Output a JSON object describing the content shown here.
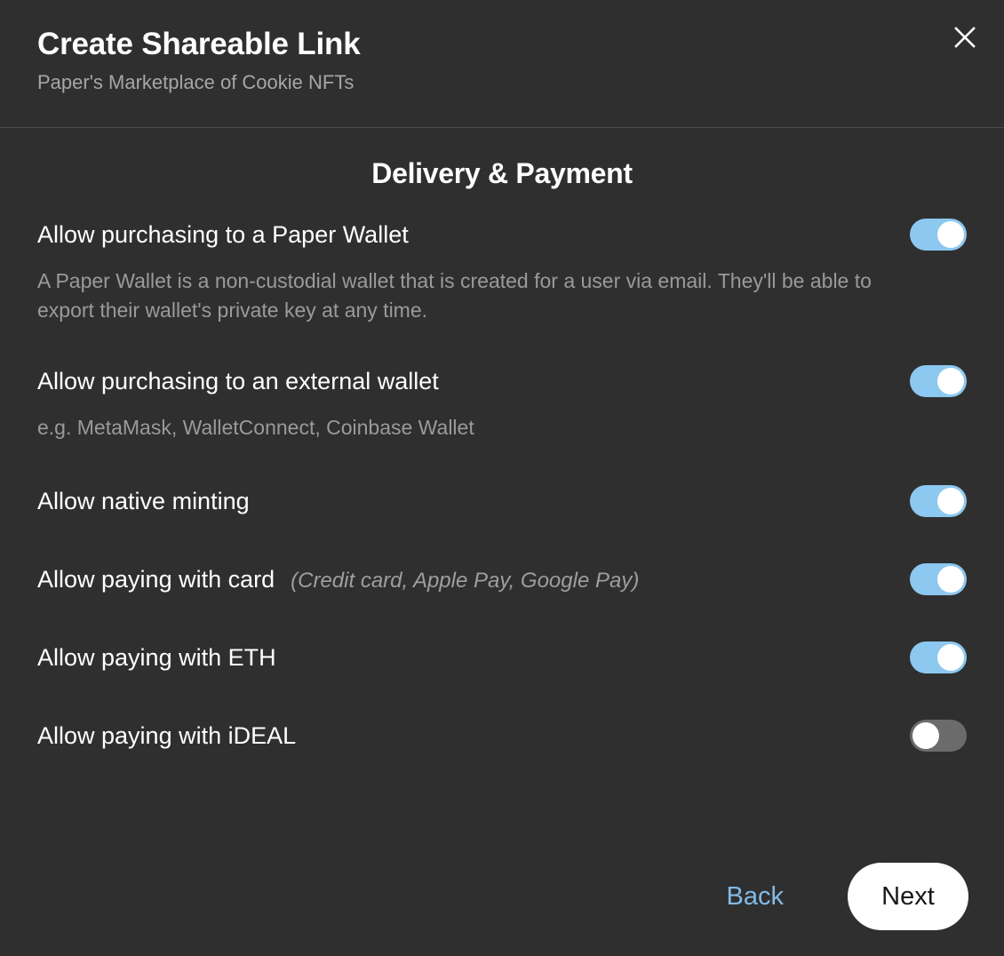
{
  "header": {
    "title": "Create Shareable Link",
    "subtitle": "Paper's Marketplace of Cookie NFTs",
    "close_icon": "close-icon"
  },
  "main": {
    "section_heading": "Delivery & Payment",
    "options": [
      {
        "label": "Allow purchasing to a Paper Wallet",
        "hint": "",
        "description": "A Paper Wallet is a non-custodial wallet that is created for a user via email. They'll be able to export their wallet's private key at any time.",
        "toggle_state": "on"
      },
      {
        "label": "Allow purchasing to an external wallet",
        "hint": "",
        "description": "e.g. MetaMask, WalletConnect, Coinbase Wallet",
        "toggle_state": "on"
      },
      {
        "label": "Allow native minting",
        "hint": "",
        "description": "",
        "toggle_state": "on"
      },
      {
        "label": "Allow paying with card",
        "hint": "(Credit card, Apple Pay, Google Pay)",
        "description": "",
        "toggle_state": "on"
      },
      {
        "label": "Allow paying with ETH",
        "hint": "",
        "description": "",
        "toggle_state": "on"
      },
      {
        "label": "Allow paying with iDEAL",
        "hint": "",
        "description": "",
        "toggle_state": "off"
      }
    ]
  },
  "footer": {
    "back_label": "Back",
    "next_label": "Next"
  },
  "colors": {
    "background": "#2f2f2f",
    "toggle_on": "#8cc8f0",
    "toggle_off": "#6b6b6b",
    "link": "#82bbe8",
    "primary_button_bg": "#ffffff",
    "muted_text": "#9a9a9a",
    "divider": "#4a4a4a"
  }
}
